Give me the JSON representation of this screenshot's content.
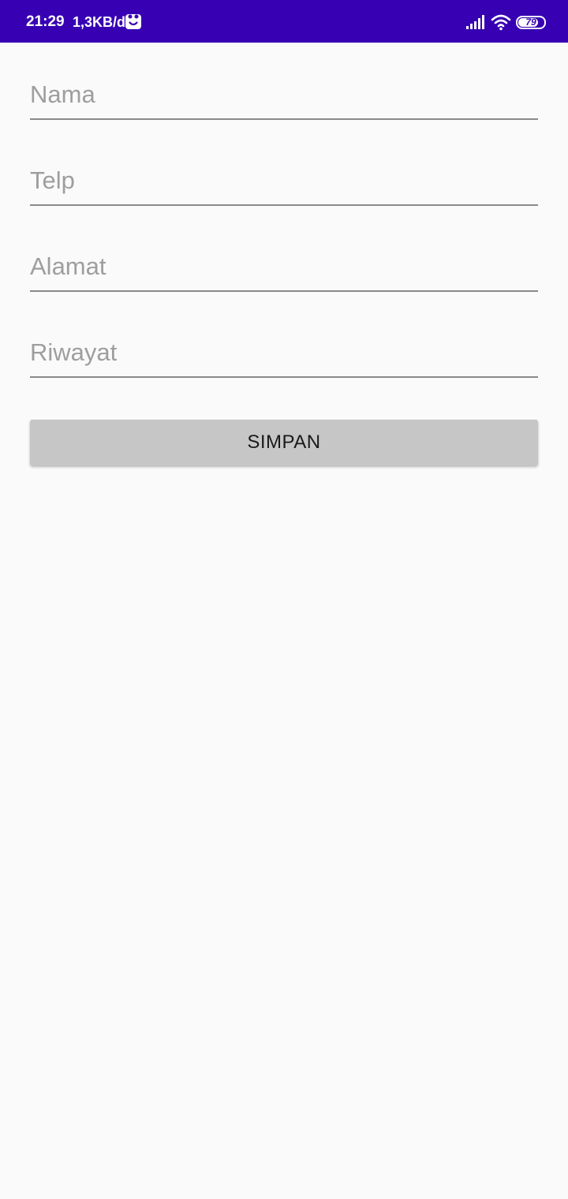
{
  "status_bar": {
    "time": "21:29",
    "net_speed": "1,3KB/d",
    "battery_level": "79",
    "battery_fraction": 0.79,
    "background_color": "#3700b3",
    "icons": [
      "app-notification-icon",
      "signal-icon",
      "wifi-icon",
      "battery-icon"
    ]
  },
  "form": {
    "fields": [
      {
        "placeholder": "Nama",
        "value": ""
      },
      {
        "placeholder": "Telp",
        "value": ""
      },
      {
        "placeholder": "Alamat",
        "value": ""
      },
      {
        "placeholder": "Riwayat",
        "value": ""
      }
    ],
    "save_label": "SIMPAN"
  }
}
